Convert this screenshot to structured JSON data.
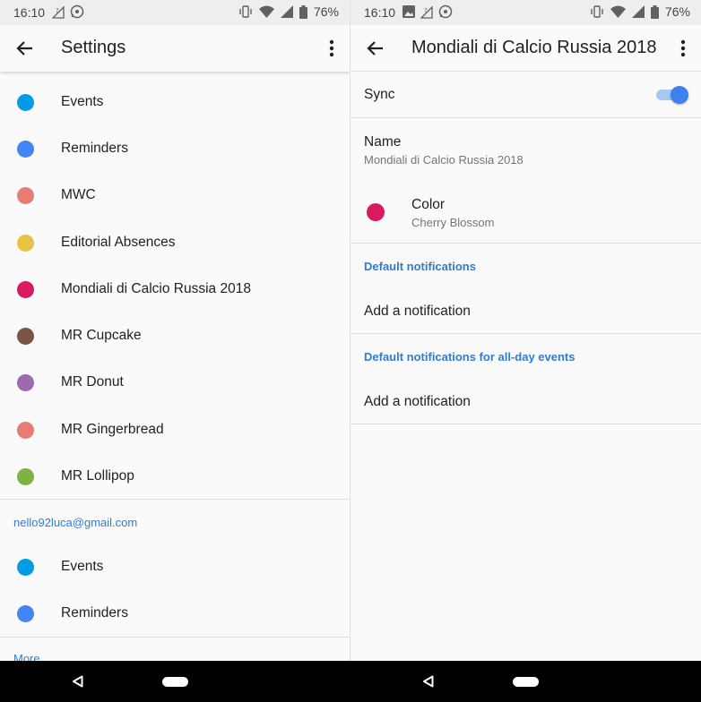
{
  "colors": {
    "accent": "#2f7bd6",
    "switch_on": "#3d82ec"
  },
  "left": {
    "status": {
      "time": "16:10",
      "battery": "76%"
    },
    "toolbar": {
      "title": "Settings",
      "back_icon": "arrow-left-icon",
      "menu_icon": "more-vert-icon"
    },
    "calendars": [
      {
        "label": "Events",
        "color": "#039be5"
      },
      {
        "label": "Reminders",
        "color": "#4285f4"
      },
      {
        "label": "MWC",
        "color": "#e67c73"
      },
      {
        "label": "Editorial Absences",
        "color": "#e4c441"
      },
      {
        "label": "Mondiali di Calcio Russia 2018",
        "color": "#d81b60"
      },
      {
        "label": "MR Cupcake",
        "color": "#795548"
      },
      {
        "label": "MR Donut",
        "color": "#9e69af"
      },
      {
        "label": "MR Gingerbread",
        "color": "#e67c73"
      },
      {
        "label": "MR Lollipop",
        "color": "#7cb342"
      }
    ],
    "account": "nello92luca@gmail.com",
    "account_calendars": [
      {
        "label": "Events",
        "color": "#039be5"
      },
      {
        "label": "Reminders",
        "color": "#4285f4"
      }
    ],
    "more_label": "More"
  },
  "right": {
    "status": {
      "time": "16:10",
      "battery": "76%"
    },
    "toolbar": {
      "title": "Mondiali di Calcio Russia 2018",
      "back_icon": "arrow-left-icon",
      "menu_icon": "more-vert-icon"
    },
    "sync": {
      "label": "Sync",
      "on": true
    },
    "name": {
      "label": "Name",
      "value": "Mondiali di Calcio Russia 2018"
    },
    "color": {
      "label": "Color",
      "value": "Cherry Blossom",
      "swatch": "#d81b60"
    },
    "default_notifications": {
      "header": "Default notifications",
      "add_label": "Add a notification"
    },
    "allday_notifications": {
      "header": "Default notifications for all-day events",
      "add_label": "Add a notification"
    }
  }
}
